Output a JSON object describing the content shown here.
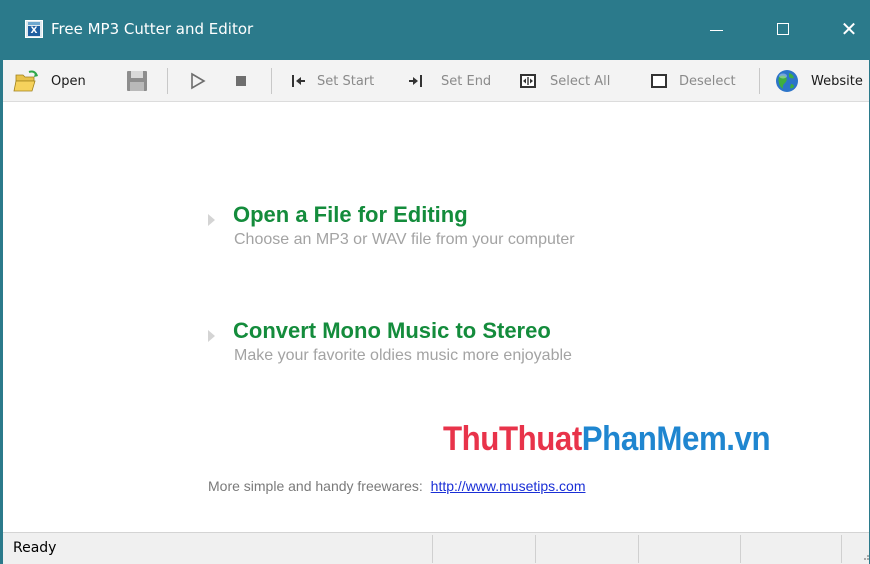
{
  "window": {
    "title": "Free MP3 Cutter and Editor",
    "titlebar_color": "#2b7a8b",
    "minimize_icon": "minimize-icon",
    "maximize_icon": "maximize-icon",
    "close_icon": "close-icon",
    "close_glyph": "✕"
  },
  "toolbar": {
    "open_label": "Open",
    "open_icon": "folder-open-icon",
    "save_icon": "save-disk-icon",
    "play_icon": "play-icon",
    "stop_icon": "stop-icon",
    "set_start_label": "Set Start",
    "set_start_icon": "set-start-icon",
    "set_end_label": "Set End",
    "set_end_icon": "set-end-icon",
    "select_all_label": "Select All",
    "select_all_icon": "select-all-icon",
    "deselect_label": "Deselect",
    "deselect_icon": "deselect-icon",
    "website_label": "Website",
    "website_icon": "globe-icon"
  },
  "tasks": [
    {
      "title": "Open a File for Editing",
      "subtitle": "Choose an MP3 or WAV file from your computer"
    },
    {
      "title": "Convert Mono Music to Stereo",
      "subtitle": "Make your favorite oldies music more enjoyable"
    }
  ],
  "watermark": {
    "part1": "ThuThuat",
    "part2": "PhanMem.vn"
  },
  "footer": {
    "text": "More simple and handy freewares:",
    "link": "http://www.musetips.com"
  },
  "status": {
    "text": "Ready"
  },
  "colors": {
    "accent_green": "#148c3c",
    "link_blue": "#1a2fd6"
  }
}
